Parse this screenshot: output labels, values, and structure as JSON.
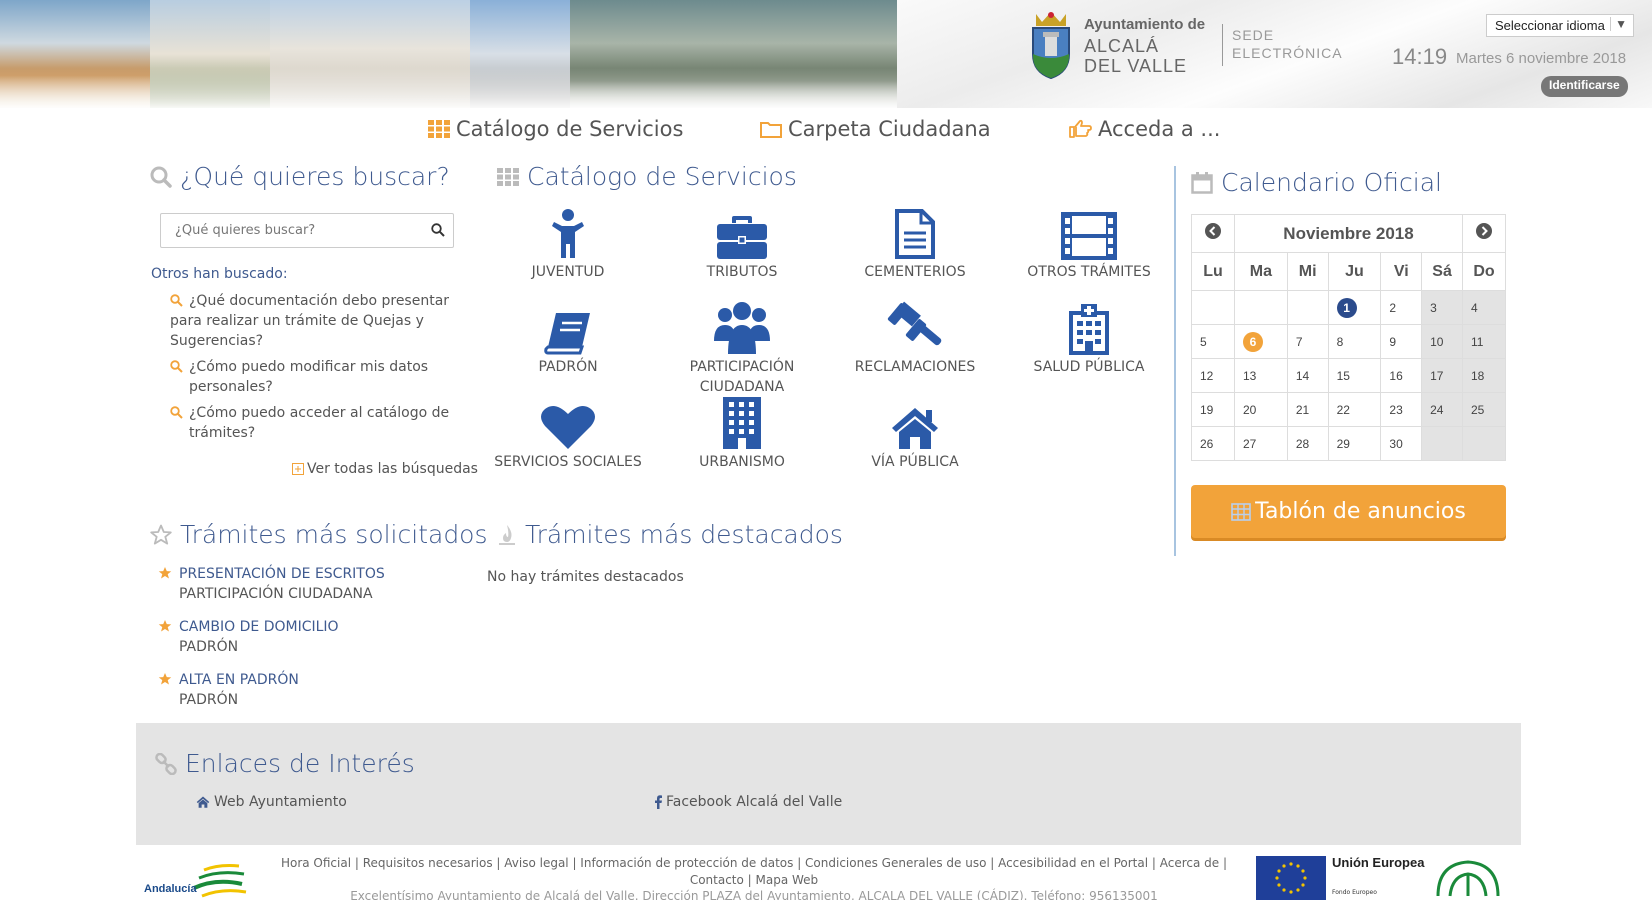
{
  "header": {
    "town_line1": "Ayuntamiento de",
    "town_line2": "ALCALÁ",
    "town_line3": "DEL VALLE",
    "sede_line1": "SEDE",
    "sede_line2": "ELECTRÓNICA",
    "language_select": "Seleccionar idioma",
    "time": "14:19",
    "date": "Martes 6 noviembre 2018",
    "login_label": "Identificarse"
  },
  "topnav": {
    "catalog": "Catálogo de Servicios",
    "folder": "Carpeta Ciudadana",
    "access": "Acceda a ..."
  },
  "search": {
    "title": "¿Qué quieres buscar?",
    "placeholder": "¿Qué quieres buscar?",
    "others_label": "Otros han buscado:",
    "faqs": [
      "¿Qué documentación debo presentar para realizar un trámite de Quejas y Sugerencias?",
      "¿Cómo puedo modificar mis datos personales?",
      "¿Cómo puedo acceder al catálogo de trámites?"
    ],
    "see_all": "Ver todas las búsquedas"
  },
  "catalog": {
    "title": "Catálogo de Servicios",
    "items": [
      {
        "label": "JUVENTUD",
        "icon": "person-icon"
      },
      {
        "label": "TRIBUTOS",
        "icon": "briefcase-icon"
      },
      {
        "label": "CEMENTERIOS",
        "icon": "document-icon"
      },
      {
        "label": "OTROS TRÁMITES",
        "icon": "film-icon"
      },
      {
        "label": "PADRÓN",
        "icon": "book-icon"
      },
      {
        "label": "PARTICIPACIÓN CIUDADANA",
        "icon": "group-icon"
      },
      {
        "label": "RECLAMACIONES",
        "icon": "gavel-icon"
      },
      {
        "label": "SALUD PÚBLICA",
        "icon": "hospital-icon"
      },
      {
        "label": "SERVICIOS SOCIALES",
        "icon": "heart-icon"
      },
      {
        "label": "URBANISMO",
        "icon": "building-icon"
      },
      {
        "label": "VÍA PÚBLICA",
        "icon": "home-icon"
      }
    ]
  },
  "calendar": {
    "title": "Calendario Oficial",
    "month": "Noviembre 2018",
    "weekdays": [
      "Lu",
      "Ma",
      "Mi",
      "Ju",
      "Vi",
      "Sá",
      "Do"
    ],
    "weeks": [
      [
        "",
        "",
        "",
        "1",
        "2",
        "3",
        "4"
      ],
      [
        "5",
        "6",
        "7",
        "8",
        "9",
        "10",
        "11"
      ],
      [
        "12",
        "13",
        "14",
        "15",
        "16",
        "17",
        "18"
      ],
      [
        "19",
        "20",
        "21",
        "22",
        "23",
        "24",
        "25"
      ],
      [
        "26",
        "27",
        "28",
        "29",
        "30",
        "",
        ""
      ]
    ],
    "holiday_day": "1",
    "today_day": "6",
    "holiday_color": "#2b4b8c",
    "today_color": "#f2a33a"
  },
  "tablon": {
    "label": "Tablón de anuncios"
  },
  "requested": {
    "title": "Trámites más solicitados",
    "items": [
      {
        "name": "PRESENTACIÓN DE ESCRITOS",
        "category": "PARTICIPACIÓN CIUDADANA"
      },
      {
        "name": "CAMBIO DE DOMICILIO",
        "category": "PADRÓN"
      },
      {
        "name": "ALTA EN PADRÓN",
        "category": "PADRÓN"
      }
    ]
  },
  "featured": {
    "title": "Trámites más destacados",
    "empty_text": "No hay trámites destacados"
  },
  "links": {
    "title": "Enlaces de Interés",
    "web": "Web Ayuntamiento",
    "facebook": "Facebook Alcalá del Valle"
  },
  "footer": {
    "links_text": "Hora Oficial | Requisitos necesarios | Aviso legal | Información de protección de datos | Condiciones Generales de uso | Accesibilidad en el Portal | Acerca de | Contacto | Mapa Web",
    "address": "Excelentísimo Ayuntamiento de Alcalá del Valle. Dirección PLAZA del Ayuntamiento, ALCALA DEL VALLE (CÁDIZ). Teléfono: 956135001",
    "eu_label": "Unión Europea",
    "eu_sub": "Fondo Europeo",
    "andalucia_label": "Andalucía"
  },
  "colors": {
    "accent_blue": "#2b5aa8",
    "title_blue": "#3f5a8f",
    "orange": "#f2a33a"
  }
}
